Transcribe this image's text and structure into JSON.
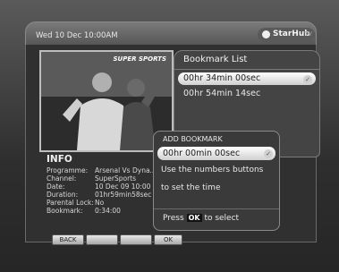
{
  "header": {
    "datetime": "Wed 10 Dec 10:00AM",
    "brand": "StarHub",
    "brand_suffix": "TV"
  },
  "video": {
    "watermark": "SUPER SPORTS"
  },
  "info": {
    "title": "INFO",
    "rows": [
      {
        "label": "Programme:",
        "value": "Arsenal Vs Dyna..."
      },
      {
        "label": "Channel:",
        "value": "SuperSports"
      },
      {
        "label": "Date:",
        "value": "10 Dec 09 10:00"
      },
      {
        "label": "Duration:",
        "value": "01hr59min58sec"
      },
      {
        "label": "Parental Lock:",
        "value": "No"
      },
      {
        "label": "Bookmark:",
        "value": "0:34:00"
      }
    ]
  },
  "buttons": {
    "back": "BACK",
    "ok": "OK"
  },
  "bookmark_list": {
    "title": "Bookmark List",
    "items": [
      "00hr 34min 00sec",
      "00hr 54min 14sec"
    ]
  },
  "dialog": {
    "title": "ADD BOOKMARK",
    "time_value": "00hr 00min 00sec",
    "hint_line1": "Use the numbers buttons",
    "hint_line2": "to set the time",
    "footer_pre": "Press",
    "footer_key": "OK",
    "footer_post": "to select"
  }
}
